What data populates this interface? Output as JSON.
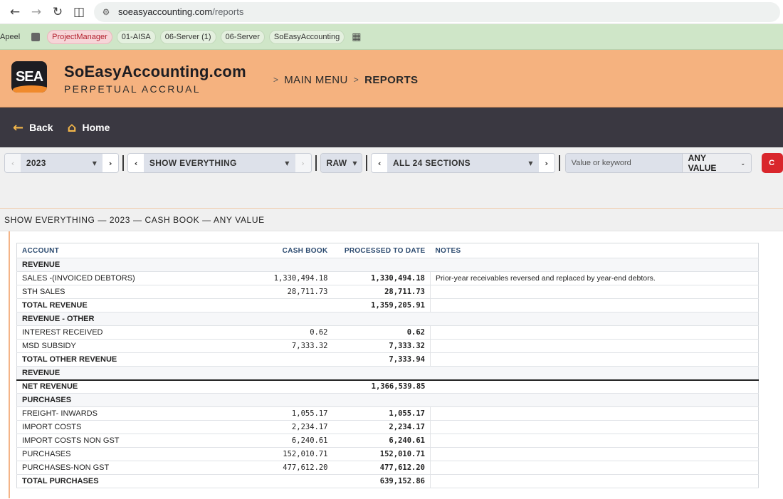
{
  "browser": {
    "url_host": "soeasyaccounting.com",
    "url_path": "/reports",
    "bookmarks": [
      {
        "label": "Apeel"
      },
      {
        "label": "ProjectManager"
      },
      {
        "label": "01-AISA"
      },
      {
        "label": "06-Server (1)"
      },
      {
        "label": "06-Server"
      },
      {
        "label": "SoEasyAccounting"
      }
    ]
  },
  "header": {
    "logo_text": "SEA",
    "brand_name": "SoEasyAccounting.com",
    "brand_sub": "PERPETUAL ACCRUAL",
    "crumb_sep": ">",
    "crumbs": [
      "MAIN MENU",
      "REPORTS"
    ]
  },
  "nav": {
    "back_label": "Back",
    "home_label": "Home"
  },
  "filters": {
    "year": "2023",
    "view": "SHOW EVERYTHING",
    "format": "RAW",
    "sections": "ALL 24 SECTIONS",
    "search_placeholder": "Value or keyword",
    "value_filter": "ANY VALUE",
    "red_button_label": "C"
  },
  "report": {
    "title": "SHOW EVERYTHING — 2023 — CASH BOOK — ANY VALUE",
    "columns": [
      "ACCOUNT",
      "CASH BOOK",
      "PROCESSED TO DATE",
      "NOTES"
    ],
    "rows": [
      {
        "account": "REVENUE"
      },
      {
        "account": "SALES -(INVOICED DEBTORS)",
        "cash": "1,330,494.18",
        "processed": "1,330,494.18",
        "note": "Prior-year receivables reversed and replaced by year-end debtors."
      },
      {
        "account": "STH SALES",
        "cash": "28,711.73",
        "processed": "28,711.73"
      },
      {
        "account": "TOTAL REVENUE",
        "processed": "1,359,205.91"
      },
      {
        "account": "REVENUE - OTHER"
      },
      {
        "account": "INTEREST RECEIVED",
        "cash": "0.62",
        "processed": "0.62"
      },
      {
        "account": "MSD SUBSIDY",
        "cash": "7,333.32",
        "processed": "7,333.32"
      },
      {
        "account": "TOTAL OTHER REVENUE",
        "processed": "7,333.94"
      },
      {
        "account": "REVENUE"
      },
      {
        "account": "NET REVENUE",
        "processed": "1,366,539.85"
      },
      {
        "account": "PURCHASES"
      },
      {
        "account": "FREIGHT- INWARDS",
        "cash": "1,055.17",
        "processed": "1,055.17"
      },
      {
        "account": "IMPORT COSTS",
        "cash": "2,234.17",
        "processed": "2,234.17"
      },
      {
        "account": "IMPORT COSTS NON GST",
        "cash": "6,240.61",
        "processed": "6,240.61"
      },
      {
        "account": "PURCHASES",
        "cash": "152,010.71",
        "processed": "152,010.71"
      },
      {
        "account": "PURCHASES-NON GST",
        "cash": "477,612.20",
        "processed": "477,612.20"
      },
      {
        "account": "TOTAL PURCHASES",
        "processed": "639,152.86"
      }
    ]
  }
}
